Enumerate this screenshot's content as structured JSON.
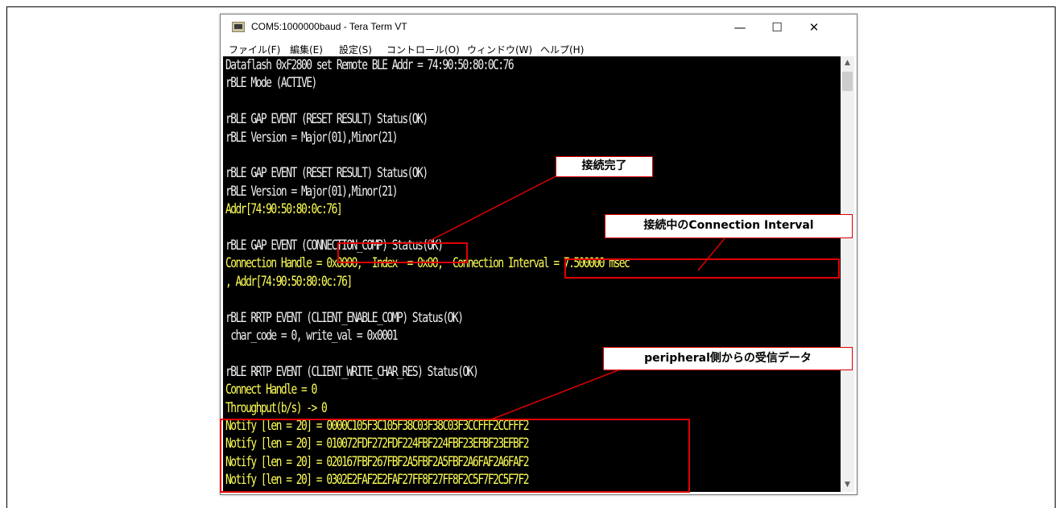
{
  "window": {
    "title": "COM5:1000000baud - Tera Term VT",
    "controls": {
      "minimize": "—",
      "maximize": "☐",
      "close": "✕"
    }
  },
  "menu": [
    "ファイル(F)",
    "編集(E)",
    "設定(S)",
    "コントロール(O)",
    "ウィンドウ(W)",
    "ヘルプ(H)"
  ],
  "terminal": {
    "lines": [
      {
        "text": "Dataflash 0xF2800 set Remote BLE Addr = 74:90:50:80:0C:76",
        "color": "white"
      },
      {
        "text": "rBLE Mode (ACTIVE)",
        "color": "white"
      },
      {
        "text": "",
        "color": "white"
      },
      {
        "text": "rBLE GAP EVENT (RESET RESULT) Status(OK)",
        "color": "white"
      },
      {
        "text": "rBLE Version = Major(01),Minor(21)",
        "color": "white"
      },
      {
        "text": "",
        "color": "white"
      },
      {
        "text": "rBLE GAP EVENT (RESET RESULT) Status(OK)",
        "color": "white"
      },
      {
        "text": "rBLE Version = Major(01),Minor(21)",
        "color": "white"
      },
      {
        "text": "Addr[74:90:50:80:0c:76]",
        "color": "yellow"
      },
      {
        "text": "",
        "color": "white"
      },
      {
        "text": "rBLE GAP EVENT (CONNECTION_COMP) Status(OK)",
        "color": "white"
      },
      {
        "text": "Connection Handle = 0x0000,  Index  = 0x00,  Connection Interval = 7.500000 msec",
        "color": "yellow"
      },
      {
        "text": ", Addr[74:90:50:80:0c:76]",
        "color": "yellow"
      },
      {
        "text": "",
        "color": "white"
      },
      {
        "text": "rBLE RRTP EVENT (CLIENT_ENABLE_COMP) Status(OK)",
        "color": "white"
      },
      {
        "text": " char_code = 0, write_val = 0x0001",
        "color": "white"
      },
      {
        "text": "",
        "color": "white"
      },
      {
        "text": "rBLE RRTP EVENT (CLIENT_WRITE_CHAR_RES) Status(OK)",
        "color": "white"
      },
      {
        "text": "Connect Handle = 0",
        "color": "yellow"
      },
      {
        "text": "Throughput(b/s) -> 0",
        "color": "yellow"
      },
      {
        "text": "Notify [len = 20] = 0000C105F3C105F38C03F38C03F3CCFFF2CCFFF2",
        "color": "yellow"
      },
      {
        "text": "Notify [len = 20] = 010072FDF272FDF224FBF224FBF23EFBF23EFBF2",
        "color": "yellow"
      },
      {
        "text": "Notify [len = 20] = 020167FBF267FBF2A5FBF2A5FBF2A6FAF2A6FAF2",
        "color": "yellow"
      },
      {
        "text": "Notify [len = 20] = 0302E2FAF2E2FAF27FF8F27FF8F2C5F7F2C5F7F2",
        "color": "yellow"
      }
    ]
  },
  "annotations": {
    "connection_complete": "接続完了",
    "connection_interval": "接続中のConnection Interval",
    "received_data": "peripheral側からの受信データ"
  },
  "colors": {
    "terminal_bg": "#000000",
    "text_white": "#f2f2f2",
    "text_yellow": "#ffff55",
    "annotation_red": "#e00000"
  }
}
